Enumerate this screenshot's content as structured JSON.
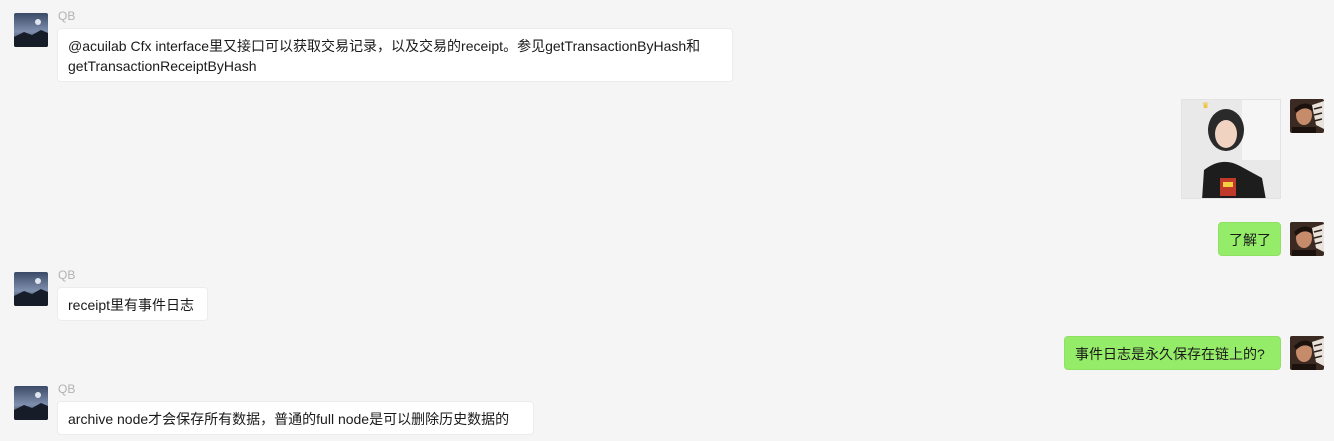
{
  "messages": [
    {
      "side": "in",
      "sender": "QB",
      "lines": [
        "@acuilab Cfx interface里又接口可以获取交易记录，以及交易的receipt。参见getTransactionByHash和",
        "getTransactionReceiptByHash"
      ]
    },
    {
      "side": "out",
      "type": "image",
      "image_desc": "photo-sticker"
    },
    {
      "side": "out",
      "text": "了解了"
    },
    {
      "side": "in",
      "sender": "QB",
      "text": "receipt里有事件日志"
    },
    {
      "side": "out",
      "text": "事件日志是永久保存在链上的?"
    },
    {
      "side": "in",
      "sender": "QB",
      "text": "archive node才会保存所有数据，普通的full node是可以删除历史数据的"
    }
  ],
  "colors": {
    "background": "#f5f5f5",
    "incoming_bubble": "#ffffff",
    "outgoing_bubble": "#95ec69",
    "sender_name": "#b2b2b2"
  }
}
